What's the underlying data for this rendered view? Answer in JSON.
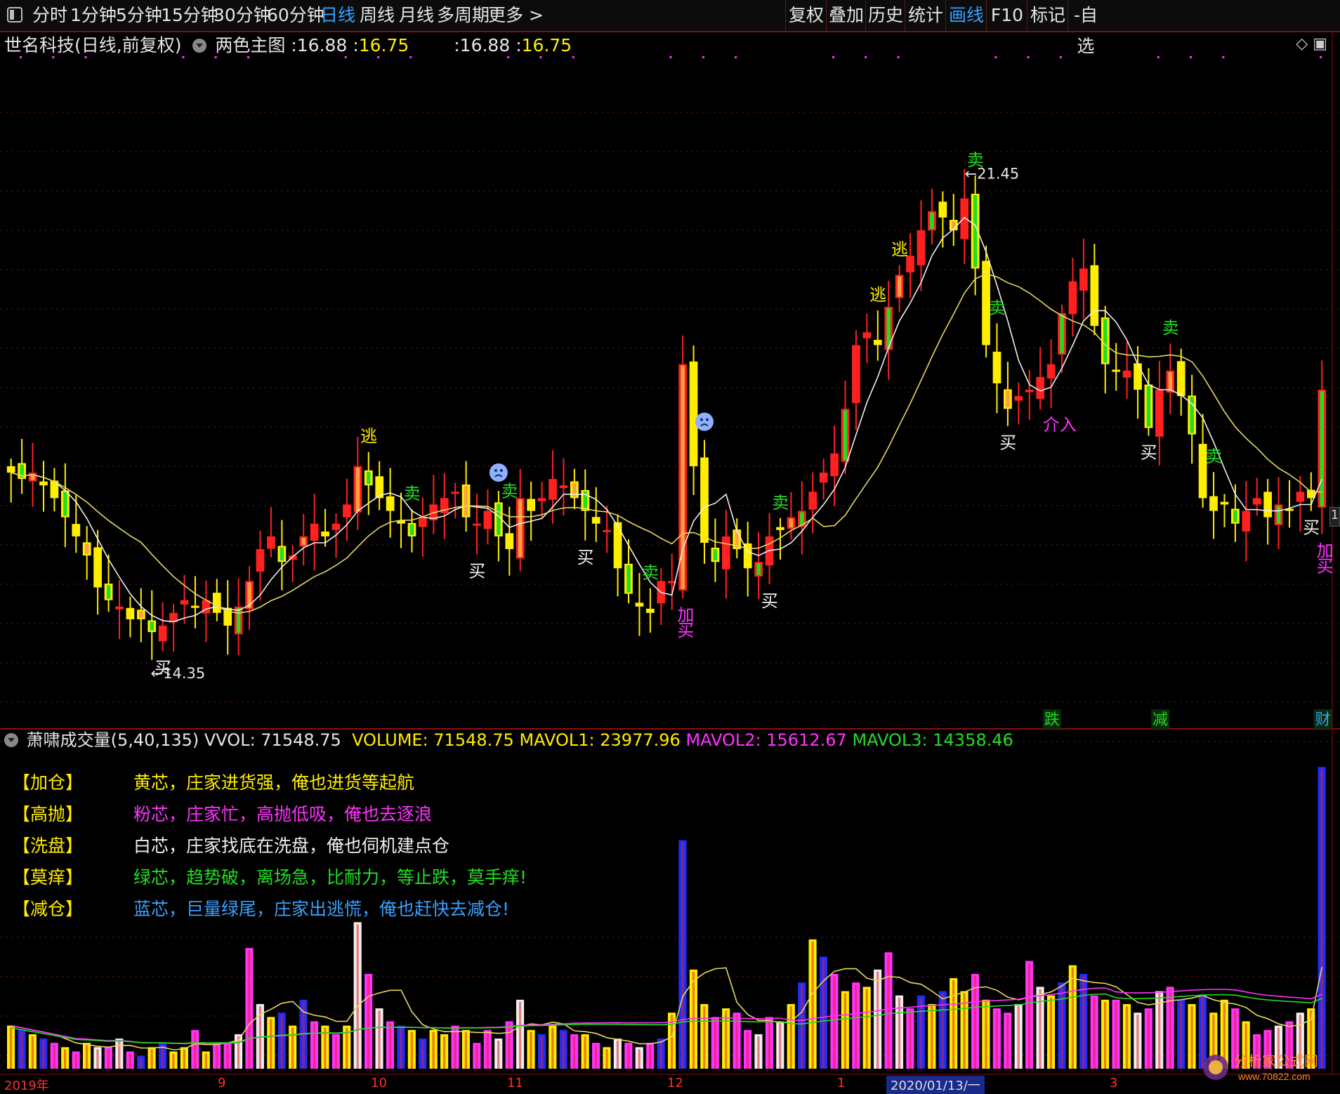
{
  "toolbar": {
    "periods": [
      "分时",
      "1分钟",
      "5分钟",
      "15分钟",
      "30分钟",
      "60分钟",
      "日线",
      "周线",
      "月线",
      "多周期",
      "更多 >"
    ],
    "active_period": "日线",
    "right_buttons": [
      "复权",
      "叠加",
      "历史",
      "统计",
      "画线",
      "F10",
      "标记",
      "-自选"
    ],
    "active_right": "画线"
  },
  "main_header": {
    "stock": "世名科技(日线,前复权)",
    "indicator": "两色主图",
    "v1_label": ":",
    "v1": "16.88",
    "v2": "16.75",
    "v3_label": ":",
    "v3": "16.88",
    "v4": "16.75"
  },
  "volume_header": {
    "name": "萧啸成交量(5,40,135)",
    "vvol": "VVOL: 71548.75",
    "volume": "VOLUME: 71548.75",
    "mavol1": "MAVOL1: 23977.96",
    "mavol2": "MAVOL2: 15612.67",
    "mavol3": "MAVOL3: 14358.46"
  },
  "legend": [
    {
      "tag": "【加仓】",
      "text": "黄芯，庄家进货强，俺也进货等起航",
      "color": "#ffee00"
    },
    {
      "tag": "【高抛】",
      "text": "粉芯，庄家忙，高抛低吸，俺也去逐浪",
      "color": "#ff33ff"
    },
    {
      "tag": "【洗盘】",
      "text": "白芯，庄家找底在洗盘，俺也伺机建点仓",
      "color": "#f0f0f0"
    },
    {
      "tag": "【莫痒】",
      "text": "绿芯，趋势破，离场急，比耐力，等止跌，莫手痒!",
      "color": "#22dd22"
    },
    {
      "tag": "【减仓】",
      "text": "蓝芯，巨量绿尾，庄家出逃慌，俺也赶快去减仓!",
      "color": "#3aa0ff"
    }
  ],
  "date_axis": {
    "labels": [
      "2019年",
      "9",
      "10",
      "11",
      "12",
      "1",
      "2020/01/13/一",
      "3"
    ]
  },
  "right_edge_label": "1",
  "watermark": {
    "name": "分析家公式网",
    "url": "www.70822.com"
  },
  "chart_data": {
    "type": "candlestick",
    "price_range": [
      13.4,
      23.2
    ],
    "high_label": "21.45",
    "low_label": "14.35",
    "close": [
      17.0,
      16.9,
      17.0,
      16.8,
      16.6,
      16.3,
      16.0,
      15.7,
      15.2,
      15.0,
      14.9,
      14.7,
      14.7,
      14.5,
      14.6,
      14.8,
      15.0,
      14.9,
      15.0,
      14.8,
      14.6,
      14.9,
      15.3,
      15.8,
      16.0,
      15.6,
      15.7,
      16.0,
      16.2,
      16.0,
      16.2,
      16.5,
      17.1,
      16.8,
      16.6,
      16.4,
      16.2,
      16.0,
      16.3,
      16.5,
      16.6,
      16.7,
      16.3,
      16.2,
      16.4,
      16.0,
      15.8,
      16.6,
      16.4,
      16.6,
      16.9,
      16.8,
      16.6,
      16.4,
      16.2,
      16.1,
      15.5,
      15.1,
      14.9,
      14.8,
      15.3,
      15.3,
      18.7,
      17.1,
      15.9,
      15.6,
      16.0,
      15.8,
      15.5,
      15.6,
      16.0,
      16.1,
      16.3,
      16.4,
      16.7,
      17.0,
      17.3,
      18.0,
      19.0,
      19.2,
      19.0,
      19.6,
      20.1,
      20.4,
      20.8,
      21.1,
      21.0,
      20.8,
      21.3,
      20.2,
      19.0,
      18.4,
      18.0,
      18.2,
      18.3,
      18.5,
      18.7,
      19.5,
      20.0,
      20.2,
      19.3,
      18.7,
      18.6,
      18.6,
      18.3,
      17.7,
      18.3,
      18.6,
      18.2,
      17.6,
      16.6,
      16.4,
      16.5,
      16.2,
      16.4,
      16.6,
      16.3,
      16.5,
      16.4,
      16.7,
      16.6,
      18.3
    ],
    "volume_tips": [
      1.0,
      0.9,
      0.8,
      0.7,
      0.6,
      0.5,
      0.4,
      0.6,
      0.5,
      0.5,
      0.7,
      0.4,
      0.3,
      0.5,
      0.6,
      0.4,
      0.5,
      0.9,
      0.4,
      0.6,
      0.6,
      0.8,
      2.8,
      1.5,
      1.2,
      1.3,
      1.0,
      1.6,
      1.1,
      1.0,
      0.8,
      1.0,
      3.4,
      2.2,
      1.4,
      1.1,
      1.0,
      0.9,
      0.7,
      0.9,
      0.8,
      1.0,
      0.9,
      0.6,
      0.9,
      0.7,
      1.1,
      1.6,
      0.9,
      0.8,
      1.0,
      0.9,
      0.8,
      0.8,
      0.6,
      0.5,
      0.7,
      0.6,
      0.5,
      0.6,
      0.7,
      1.3,
      5.3,
      2.3,
      1.5,
      1.2,
      1.4,
      1.3,
      0.9,
      0.8,
      1.2,
      1.1,
      1.5,
      2.0,
      3.0,
      2.6,
      2.2,
      1.8,
      2.0,
      1.9,
      2.3,
      2.7,
      1.7,
      1.4,
      1.7,
      1.5,
      1.8,
      2.1,
      1.8,
      2.2,
      1.6,
      1.4,
      1.3,
      1.5,
      2.5,
      1.9,
      1.7,
      2.0,
      2.4,
      2.2,
      1.7,
      1.6,
      1.6,
      1.5,
      1.3,
      1.4,
      1.8,
      1.9,
      1.6,
      1.5,
      1.7,
      1.3,
      1.6,
      1.4,
      1.1,
      0.8,
      0.9,
      1.0,
      1.1,
      1.3,
      1.4,
      7.0
    ],
    "signals": [
      {
        "text": "买",
        "i": 14,
        "type": "buy"
      },
      {
        "text": "逃",
        "i": 33,
        "type": "escape"
      },
      {
        "text": "卖",
        "i": 37,
        "type": "sell"
      },
      {
        "text": "买",
        "i": 43,
        "type": "buy"
      },
      {
        "text": "卖",
        "i": 46,
        "type": "sell"
      },
      {
        "text": "买",
        "i": 53,
        "type": "buy"
      },
      {
        "text": "卖",
        "i": 59,
        "type": "sell"
      },
      {
        "text": "加买",
        "i": 62,
        "type": "add"
      },
      {
        "text": "买",
        "i": 70,
        "type": "buy"
      },
      {
        "text": "卖",
        "i": 71,
        "type": "sell"
      },
      {
        "text": "逃",
        "i": 80,
        "type": "escape"
      },
      {
        "text": "逃",
        "i": 82,
        "type": "escape"
      },
      {
        "text": "卖",
        "i": 89,
        "type": "sell"
      },
      {
        "text": "卖",
        "i": 91,
        "type": "sell"
      },
      {
        "text": "买",
        "i": 92,
        "type": "buy"
      },
      {
        "text": "介入",
        "i": 96,
        "type": "enter"
      },
      {
        "text": "买",
        "i": 105,
        "type": "buy"
      },
      {
        "text": "卖",
        "i": 107,
        "type": "sell"
      },
      {
        "text": "卖",
        "i": 111,
        "type": "sell"
      },
      {
        "text": "买",
        "i": 120,
        "type": "buy"
      },
      {
        "text": "加买",
        "i": 121,
        "type": "add"
      }
    ],
    "bottom_markers": [
      {
        "text": "跌",
        "i": 96
      },
      {
        "text": "减",
        "i": 106
      },
      {
        "text": "财",
        "i": 121
      }
    ],
    "sad_faces": [
      64,
      45
    ]
  }
}
